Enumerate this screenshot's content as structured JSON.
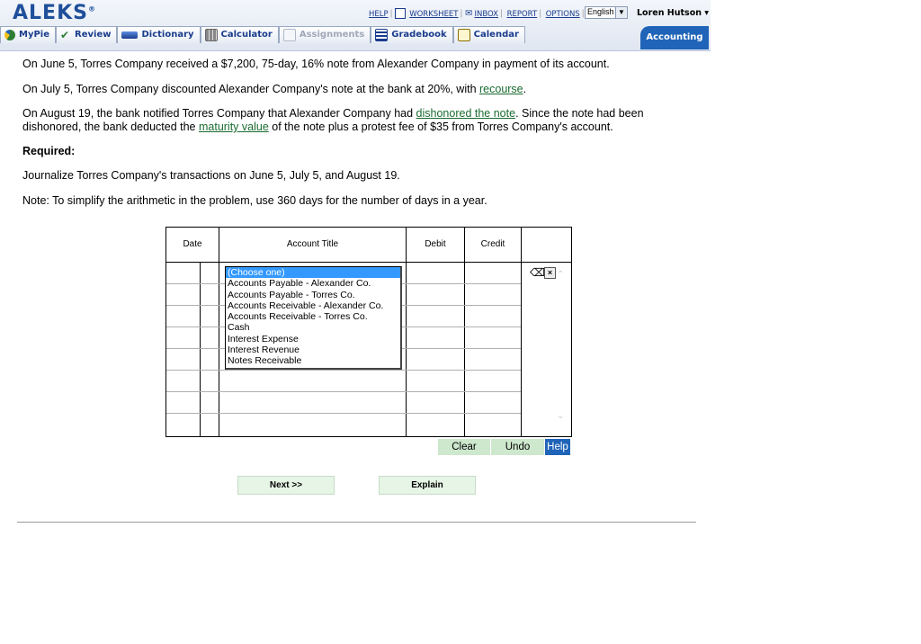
{
  "header": {
    "logo": "ALEKS",
    "links": [
      "HELP",
      "WORKSHEET",
      "INBOX",
      "REPORT",
      "OPTIONS"
    ],
    "language": "English",
    "user": "Loren Hutson ▾"
  },
  "tabs": [
    {
      "label": "MyPie",
      "icon": "pie-icon",
      "color": "#2e7d32"
    },
    {
      "label": "Review",
      "icon": "check-icon",
      "color": "#2e7d32"
    },
    {
      "label": "Dictionary",
      "icon": "book-icon",
      "color": "#1a3c8c"
    },
    {
      "label": "Calculator",
      "icon": "calculator-icon",
      "color": "#555555"
    },
    {
      "label": "Assignments",
      "icon": "assignments-icon",
      "color": "#a0a8b8"
    },
    {
      "label": "Gradebook",
      "icon": "gradebook-icon",
      "color": "#1a3c8c"
    },
    {
      "label": "Calendar",
      "icon": "calendar-icon",
      "color": "#8a6d00"
    }
  ],
  "active_tab": "Accounting",
  "problem": {
    "p1": "On June 5, Torres Company received a $7,200, 75-day, 16% note from Alexander Company in payment of its account.",
    "p2_a": "On July 5, Torres Company discounted Alexander Company's note at the bank at 20%, with ",
    "p2_link": "recourse",
    "p2_b": ".",
    "p3_a": "On August 19, the bank notified Torres Company that Alexander Company had ",
    "p3_link1": "dishonored the note",
    "p3_b": ". Since the note had been dishonored, the bank deducted the ",
    "p3_link2": "maturity value",
    "p3_c": " of the note plus a protest fee of $35 from Torres Company's account.",
    "required": "Required:",
    "p4": "Journalize Torres Company's transactions on June 5, July 5, and August 19.",
    "p5": "Note: To simplify the arithmetic in the problem, use 360 days for the number of days in a year."
  },
  "journal": {
    "headers": [
      "Date",
      "Account Title",
      "Debit",
      "Credit"
    ],
    "dropdown_options": [
      "(Choose one)",
      "Accounts Payable - Alexander Co.",
      "Accounts Payable - Torres Co.",
      "Accounts Receivable - Alexander Co.",
      "Accounts Receivable - Torres Co.",
      "Cash",
      "Interest Expense",
      "Interest Revenue",
      "Notes Receivable"
    ],
    "selected": "(Choose one)"
  },
  "actions": {
    "clear": "Clear",
    "undo": "Undo",
    "help": "Help"
  },
  "buttons": {
    "next": "Next >>",
    "explain": "Explain"
  }
}
